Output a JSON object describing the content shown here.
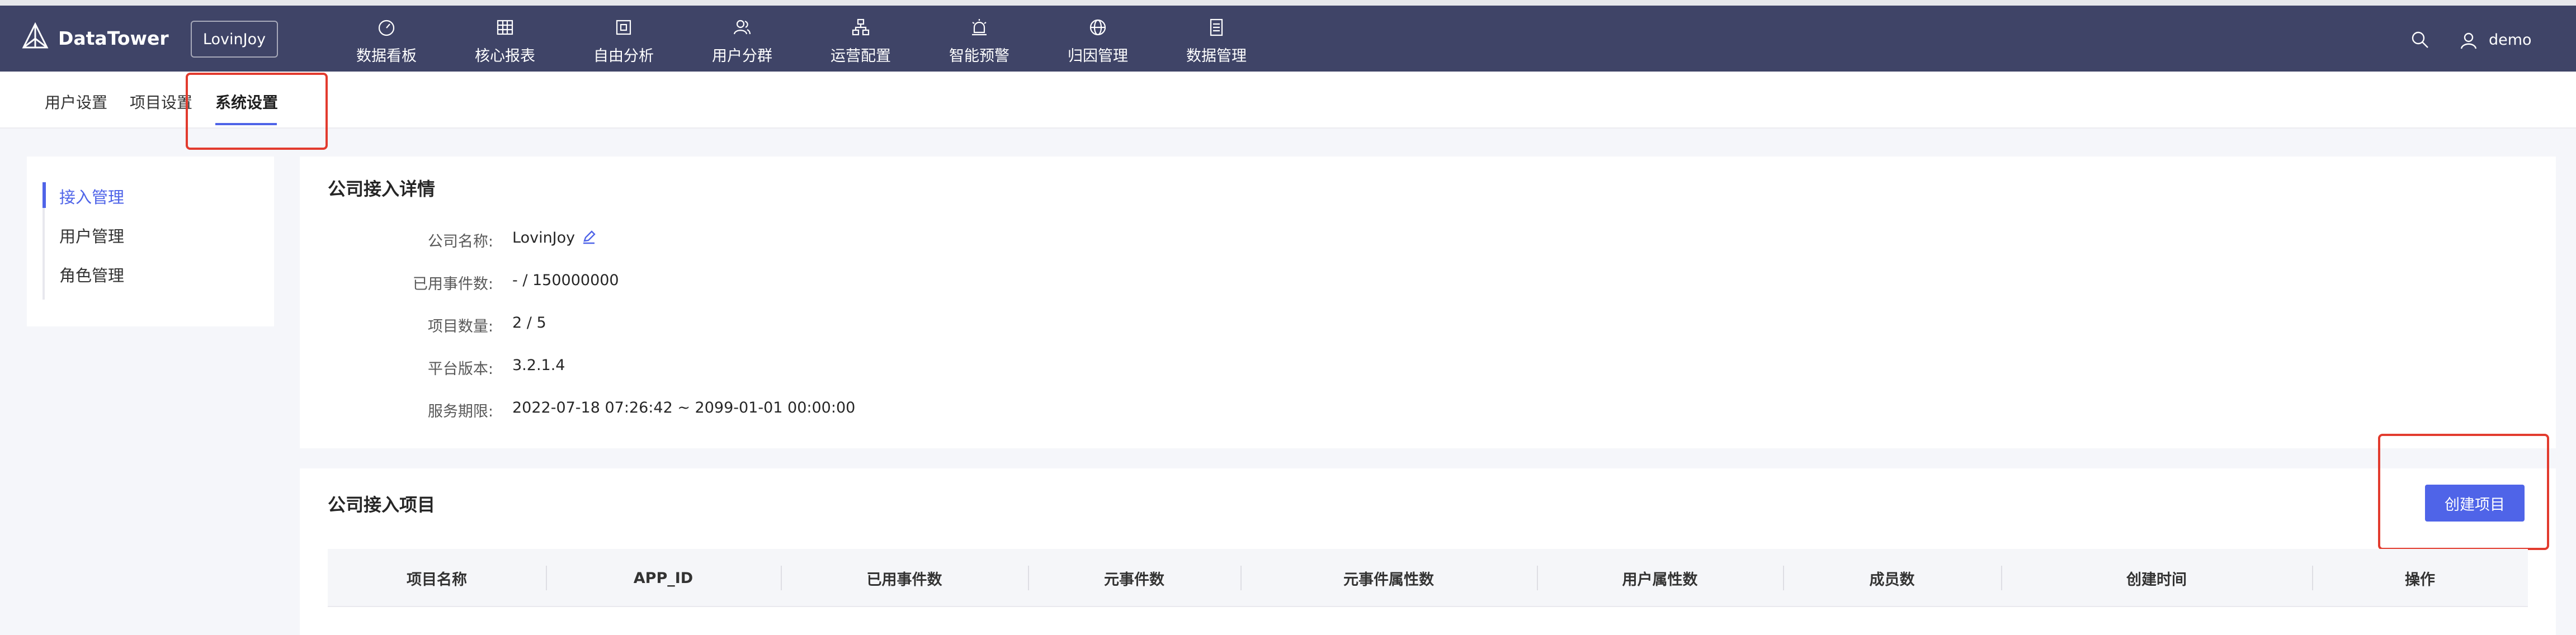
{
  "header": {
    "brand": "DataTower",
    "project": "LovinJoy",
    "nav": [
      {
        "label": "数据看板",
        "icon": "dashboard-icon"
      },
      {
        "label": "核心报表",
        "icon": "table-icon"
      },
      {
        "label": "自由分析",
        "icon": "analysis-icon"
      },
      {
        "label": "用户分群",
        "icon": "users-icon"
      },
      {
        "label": "运营配置",
        "icon": "hierarchy-icon"
      },
      {
        "label": "智能预警",
        "icon": "alarm-icon"
      },
      {
        "label": "归因管理",
        "icon": "globe-icon"
      },
      {
        "label": "数据管理",
        "icon": "document-icon"
      }
    ],
    "username": "demo"
  },
  "subnav": {
    "tabs": [
      "用户设置",
      "项目设置",
      "系统设置"
    ],
    "active": "系统设置"
  },
  "sidebar": {
    "items": [
      "接入管理",
      "用户管理",
      "角色管理"
    ],
    "active": "接入管理"
  },
  "details": {
    "title": "公司接入详情",
    "rows": [
      {
        "label": "公司名称:",
        "value": "LovinJoy"
      },
      {
        "label": "已用事件数:",
        "value": "- / 150000000"
      },
      {
        "label": "项目数量:",
        "value": "2 / 5"
      },
      {
        "label": "平台版本:",
        "value": "3.2.1.4"
      },
      {
        "label": "服务期限:",
        "value": "2022-07-18 07:26:42 ~ 2099-01-01 00:00:00"
      }
    ]
  },
  "projects": {
    "title": "公司接入项目",
    "create_label": "创建项目",
    "columns": [
      "项目名称",
      "APP_ID",
      "已用事件数",
      "元事件数",
      "元事件属性数",
      "用户属性数",
      "成员数",
      "创建时间",
      "操作"
    ]
  },
  "colors": {
    "header_bg": "#3f4467",
    "accent": "#4f64e8",
    "highlight": "#e23b2e"
  }
}
